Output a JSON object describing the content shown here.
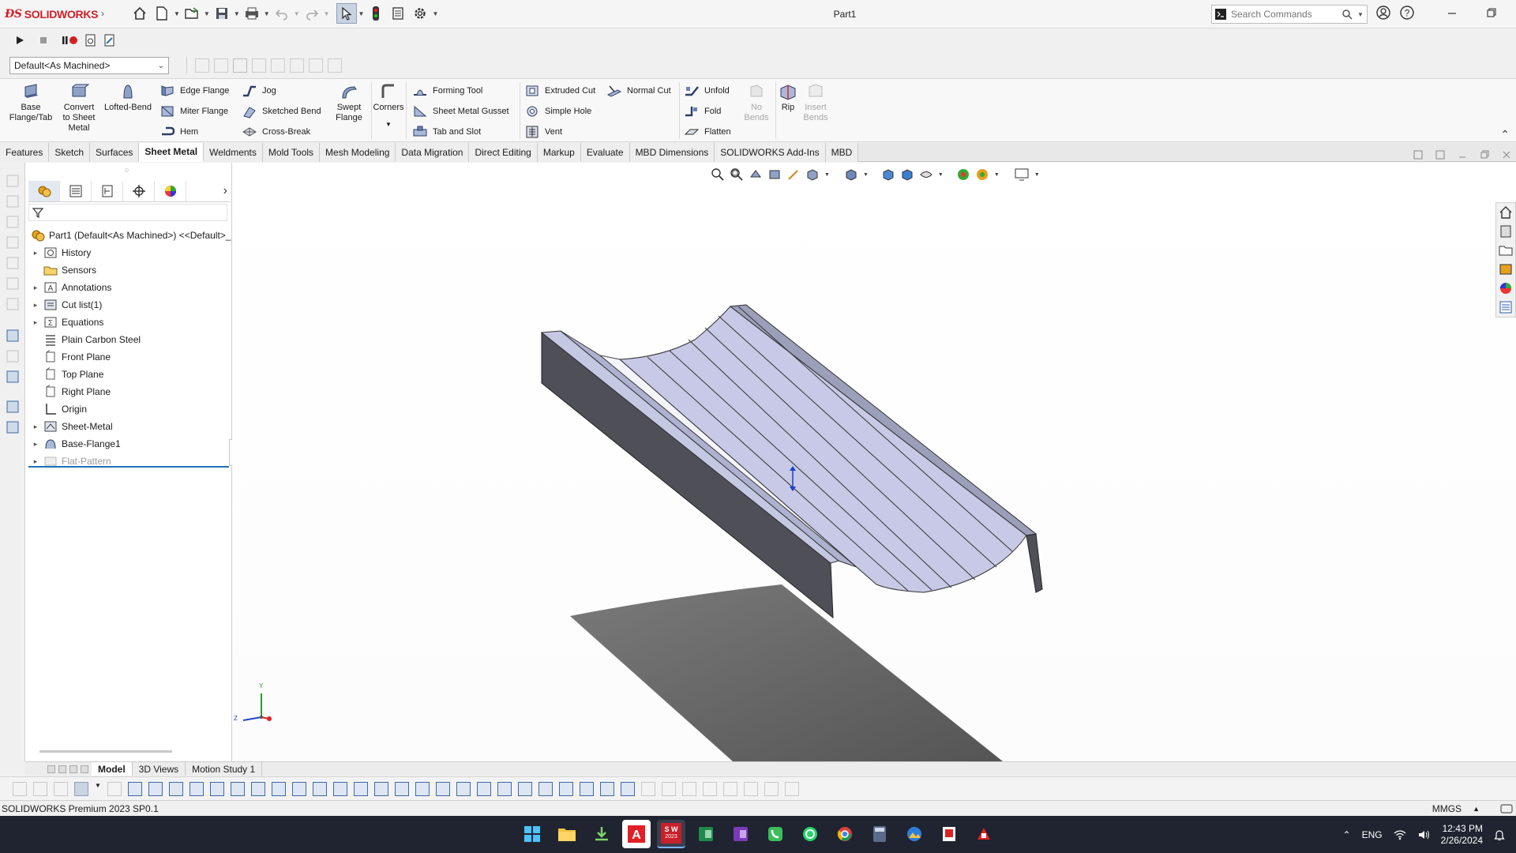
{
  "app": {
    "logo_text": "SOLIDWORKS",
    "document_title": "Part1",
    "search_placeholder": "Search Commands"
  },
  "config": {
    "selected": "Default<As Machined>"
  },
  "command_manager": {
    "big_buttons": [
      {
        "label": "Base Flange/Tab",
        "line1": "Base",
        "line2": "Flange/Tab",
        "icon": "base-flange-icon"
      },
      {
        "label": "Convert to Sheet Metal",
        "line1": "Convert",
        "line2": "to Sheet",
        "line3": "Metal",
        "icon": "convert-sheet-metal-icon"
      },
      {
        "label": "Lofted-Bend",
        "line1": "Lofted-Bend",
        "icon": "lofted-bend-icon"
      }
    ],
    "small_buttons_col1": [
      "Edge Flange",
      "Miter Flange",
      "Hem"
    ],
    "small_buttons_col2": [
      "Jog",
      "Sketched Bend",
      "Cross-Break"
    ],
    "swept_flange": {
      "line1": "Swept",
      "line2": "Flange"
    },
    "corners": "Corners",
    "small_buttons_col3": [
      "Forming Tool",
      "Sheet Metal Gusset",
      "Tab and Slot"
    ],
    "small_buttons_col4": [
      "Extruded Cut",
      "Simple Hole",
      "Vent"
    ],
    "normal_cut": "Normal Cut",
    "small_buttons_col5": [
      "Unfold",
      "Fold",
      "Flatten"
    ],
    "no_bends": {
      "line1": "No",
      "line2": "Bends"
    },
    "rip": "Rip",
    "insert_bends": {
      "line1": "Insert",
      "line2": "Bends"
    }
  },
  "tabs": [
    "Features",
    "Sketch",
    "Surfaces",
    "Sheet Metal",
    "Weldments",
    "Mold Tools",
    "Mesh Modeling",
    "Data Migration",
    "Direct Editing",
    "Markup",
    "Evaluate",
    "MBD Dimensions",
    "SOLIDWORKS Add-Ins",
    "MBD"
  ],
  "active_tab": "Sheet Metal",
  "feature_tree": {
    "root": "Part1 (Default<As Machined>) <<Default>_",
    "items": [
      {
        "label": "History",
        "expandable": true,
        "icon": "history-folder-icon",
        "greyed": false
      },
      {
        "label": "Sensors",
        "expandable": false,
        "icon": "sensors-folder-icon",
        "greyed": false
      },
      {
        "label": "Annotations",
        "expandable": true,
        "icon": "annotations-icon",
        "greyed": false
      },
      {
        "label": "Cut list(1)",
        "expandable": true,
        "icon": "cut-list-icon",
        "greyed": false
      },
      {
        "label": "Equations",
        "expandable": true,
        "icon": "equations-icon",
        "greyed": false
      },
      {
        "label": "Plain Carbon Steel",
        "expandable": false,
        "icon": "material-icon",
        "greyed": false
      },
      {
        "label": "Front Plane",
        "expandable": false,
        "icon": "plane-icon",
        "greyed": false
      },
      {
        "label": "Top Plane",
        "expandable": false,
        "icon": "plane-icon",
        "greyed": false
      },
      {
        "label": "Right Plane",
        "expandable": false,
        "icon": "plane-icon",
        "greyed": false
      },
      {
        "label": "Origin",
        "expandable": false,
        "icon": "origin-icon",
        "greyed": false
      },
      {
        "label": "Sheet-Metal",
        "expandable": true,
        "icon": "sheet-metal-folder-icon",
        "greyed": false
      },
      {
        "label": "Base-Flange1",
        "expandable": true,
        "icon": "base-flange-feature-icon",
        "greyed": false
      },
      {
        "label": "Flat-Pattern",
        "expandable": true,
        "icon": "flat-pattern-icon",
        "greyed": true
      }
    ]
  },
  "model_tabs": [
    "Model",
    "3D Views",
    "Motion Study 1"
  ],
  "active_model_tab": "Model",
  "triad": {
    "y": "Y",
    "z": "Z"
  },
  "status": {
    "left": "SOLIDWORKS Premium 2023 SP0.1",
    "units": "MMGS"
  },
  "taskbar": {
    "lang": "ENG",
    "time": "12:43 PM",
    "date": "2/26/2024",
    "sw_badge_year": "2023",
    "sw_badge_letters": "S W"
  },
  "colors": {
    "brand_red": "#d0202a",
    "active_blue": "#1f6fb5",
    "part_light": "#c9cbe6",
    "part_dark": "#4a4c56"
  }
}
